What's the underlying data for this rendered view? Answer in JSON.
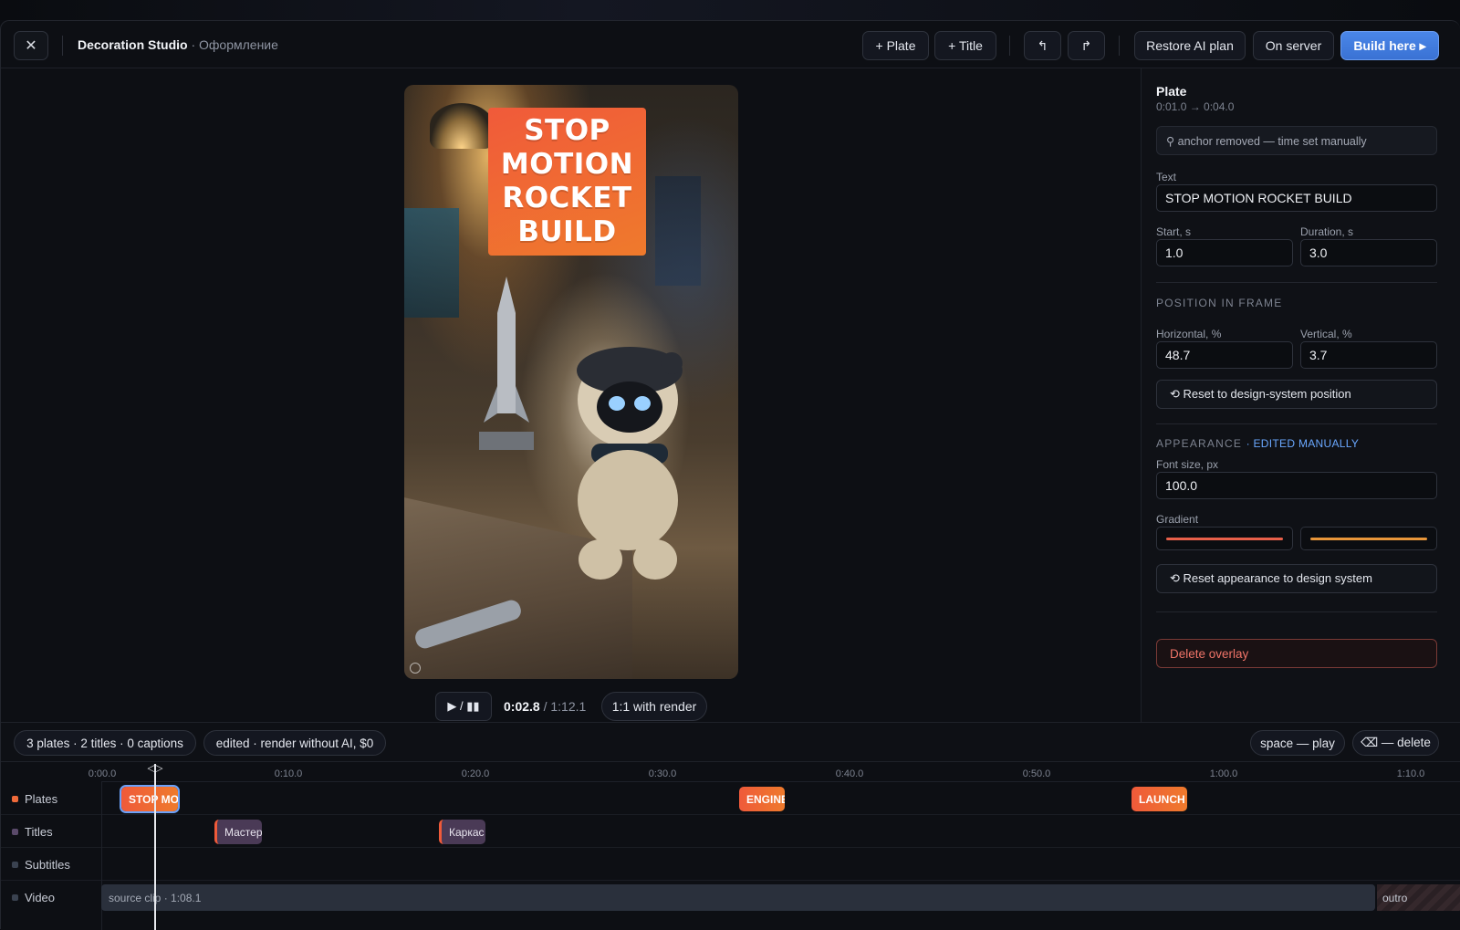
{
  "header": {
    "app_name": "Decoration Studio",
    "subtitle": "· Оформление",
    "add_plate": "+ Plate",
    "add_title": "+ Title",
    "undo_glyph": "↰",
    "redo_glyph": "↱",
    "restore_ai_plan": "Restore AI plan",
    "on_server": "On server",
    "build_here": "Build here ▸",
    "close_glyph": "✕"
  },
  "preview": {
    "plate_text_lines": [
      "STOP",
      "MOTION",
      "ROCKET",
      "BUILD"
    ],
    "play_toggle": "▶ / ▮▮",
    "current_time": "0:02.8",
    "total_time": "/ 1:12.1",
    "ratio_button": "1:1 with render"
  },
  "inspector": {
    "heading": "Plate",
    "time_range": "0:01.0 → 0:04.0",
    "anchor_note": "⚲ anchor removed — time set manually",
    "text_label": "Text",
    "text_value": "STOP MOTION ROCKET BUILD",
    "start_label": "Start, s",
    "start_value": "1.0",
    "duration_label": "Duration, s",
    "duration_value": "3.0",
    "position_section": "POSITION IN FRAME",
    "horizontal_label": "Horizontal, %",
    "horizontal_value": "48.7",
    "vertical_label": "Vertical, %",
    "vertical_value": "3.7",
    "reset_position": "⟲ Reset to design-system position",
    "appearance_section": "APPEARANCE",
    "appearance_badge": "· EDITED MANUALLY",
    "font_size_label": "Font size, px",
    "font_size_value": "100.0",
    "gradient_label": "Gradient",
    "gradient_color_1": "#e8604a",
    "gradient_color_2": "#e8963a",
    "reset_appearance": "⟲ Reset appearance to design system",
    "delete_overlay": "Delete overlay"
  },
  "status": {
    "counts": "3 plates · 2 titles · 0 captions",
    "render_state": "edited · render without AI, $0",
    "hint_play": "space — play",
    "hint_delete": "⌫ — delete"
  },
  "timeline": {
    "ticks": [
      "0:00.0",
      "0:10.0",
      "0:20.0",
      "0:30.0",
      "0:40.0",
      "0:50.0",
      "1:00.0",
      "1:10.0"
    ],
    "tracks": {
      "plates": "Plates",
      "titles": "Titles",
      "subtitles": "Subtitles",
      "video": "Video"
    },
    "plate_clips": [
      "STOP MO",
      "ENGINE",
      "LAUNCH"
    ],
    "title_clips": [
      "Мастер",
      "Каркас"
    ],
    "video_clip": "source clip · 1:08.1",
    "outro_clip": "outro",
    "playhead_glyph": "◁▷"
  },
  "colors": {
    "accent": "#4a86e8",
    "plate": "#ef5a3a",
    "danger": "#f07468"
  }
}
